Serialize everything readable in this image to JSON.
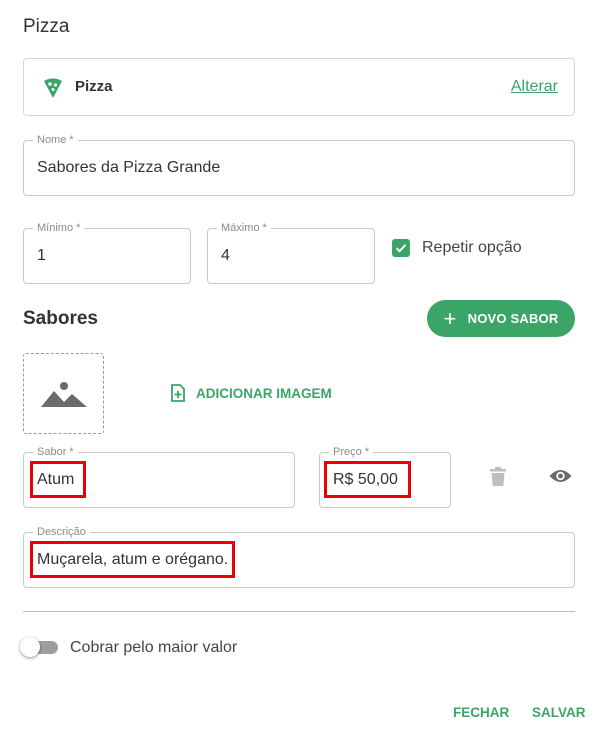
{
  "header": {
    "title": "Pizza"
  },
  "category": {
    "name": "Pizza",
    "change_label": "Alterar",
    "icon": "pizza-slice-icon"
  },
  "form": {
    "name": {
      "label": "Nome *",
      "value": "Sabores da Pizza Grande"
    },
    "minimum": {
      "label": "Mínimo *",
      "value": "1"
    },
    "maximum": {
      "label": "Máximo *",
      "value": "4"
    },
    "repeat_option": {
      "label": "Repetir opção",
      "checked": true
    }
  },
  "flavors": {
    "title": "Sabores",
    "new_button_label": "NOVO SABOR",
    "add_image_label": "ADICIONAR IMAGEM",
    "item": {
      "flavor_label": "Sabor *",
      "flavor_value": "Atum",
      "price_label": "Preço *",
      "price_value": "R$ 50,00",
      "description_label": "Descrição",
      "description_value": "Muçarela, atum e orégano."
    }
  },
  "charge_highest": {
    "label": "Cobrar pelo maior valor",
    "enabled": false
  },
  "footer": {
    "close_label": "FECHAR",
    "save_label": "SALVAR"
  },
  "colors": {
    "accent": "#3aa566",
    "highlight": "#e8000b",
    "text": "#333333",
    "border": "#c9c9c9"
  }
}
